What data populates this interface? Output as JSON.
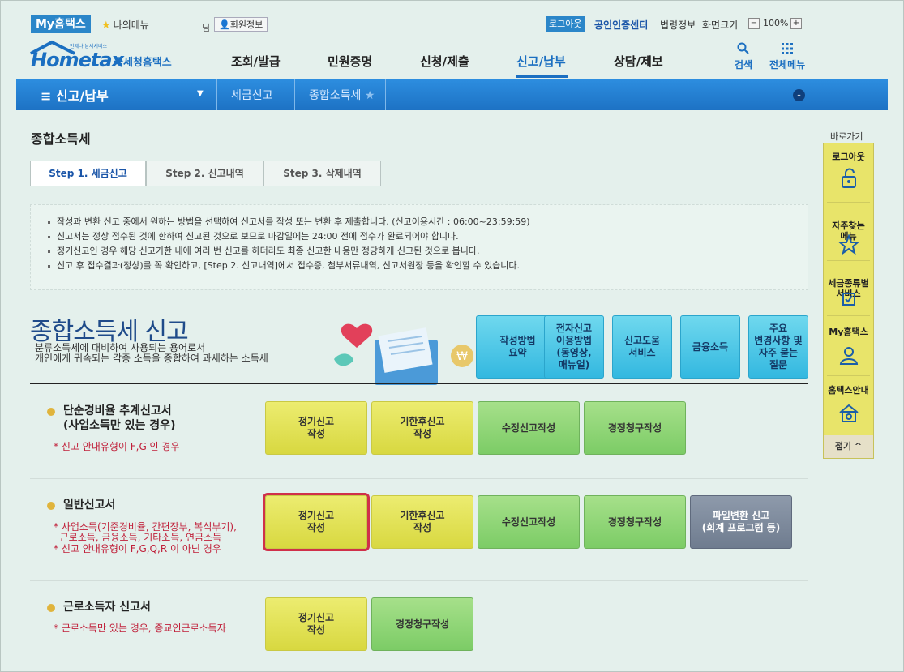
{
  "top": {
    "my_hometax": "My홈택스",
    "my_menu": "나의메뉴",
    "nim": "님",
    "member_info": "회원정보",
    "logout": "로그아웃",
    "cert_center": "공인인증센터",
    "law_info": "법령정보",
    "screen_size": "화면크기",
    "zoom_minus": "−",
    "zoom_value": "100%",
    "zoom_plus": "+"
  },
  "logo": {
    "main": "Hometax",
    "sub": "국세청홈택스",
    "small": "언제나 납세서비스"
  },
  "gnb": {
    "items": [
      "조회/발급",
      "민원증명",
      "신청/제출",
      "신고/납부",
      "상담/제보"
    ],
    "active_index": 3,
    "search": "검색",
    "all_menu": "전체메뉴"
  },
  "breadcrumb": {
    "menu": "신고/납부",
    "crumb1": "세금신고",
    "crumb2": "종합소득세"
  },
  "page": {
    "title": "종합소득세",
    "tabs": [
      "Step 1. 세금신고",
      "Step 2. 신고내역",
      "Step 3. 삭제내역"
    ],
    "info": [
      "작성과 변환 신고 중에서 원하는 방법을 선택하여 신고서를 작성 또는 변환 후 제출합니다. (신고이용시간 : 06:00~23:59:59)",
      "신고서는 정상 접수된 것에 한하여 신고된 것으로 보므로 마감일에는 24:00 전에 접수가 완료되어야 합니다.",
      "정기신고인 경우 해당 신고기한 내에 여러 번 신고를 하더라도 최종 신고한 내용만 정당하게 신고된 것으로 봅니다.",
      "신고 후 접수결과(정상)를 꼭 확인하고, [Step 2. 신고내역]에서 접수증, 첨부서류내역, 신고서원장 등을 확인할 수 있습니다."
    ]
  },
  "hero": {
    "title": "종합소득세 신고",
    "desc1": "분류소득세에 대비하여 사용되는 용어로서",
    "desc2": "개인에게 귀속되는 각종 소득을 종합하여 과세하는 소득세",
    "buttons": [
      "작성방법\n요약",
      "전자신고\n이용방법\n(동영상,\n매뉴얼)",
      "신고도움\n서비스",
      "금융소득",
      "주요\n변경사항 및\n자주 묻는\n질문"
    ]
  },
  "rows": {
    "r1": {
      "title": "단순경비율 추계신고서\n(사업소득만 있는 경우)",
      "notes": [
        "* 신고 안내유형이 F,G 인 경우"
      ],
      "buttons": [
        "정기신고\n작성",
        "기한후신고\n작성",
        "수정신고작성",
        "경정청구작성"
      ]
    },
    "r2": {
      "title": "일반신고서",
      "notes": [
        "* 사업소득(기준경비율, 간편장부, 복식부기),\n  근로소득, 금융소득, 기타소득, 연금소득",
        "* 신고 안내유형이 F,G,Q,R 이 아닌 경우"
      ],
      "buttons": [
        "정기신고\n작성",
        "기한후신고\n작성",
        "수정신고작성",
        "경정청구작성",
        "파일변환 신고\n(회계 프로그램 등)"
      ]
    },
    "r3": {
      "title": "근로소득자 신고서",
      "notes": [
        "* 근로소득만 있는 경우, 종교인근로소득자"
      ],
      "buttons": [
        "정기신고\n작성",
        "경정청구작성"
      ]
    }
  },
  "quick": {
    "title": "바로가기",
    "items": [
      "로그아웃",
      "자주찾는\n메뉴",
      "세금종류별\n서비스",
      "My홈택스",
      "홈택스안내"
    ],
    "close": "접기 ^"
  },
  "colors": {
    "brand": "#1b6fc1",
    "highlight": "#d0304a",
    "yellow_btn": "#e0e050",
    "green_btn": "#8cd474",
    "gray_btn": "#7b8799"
  }
}
